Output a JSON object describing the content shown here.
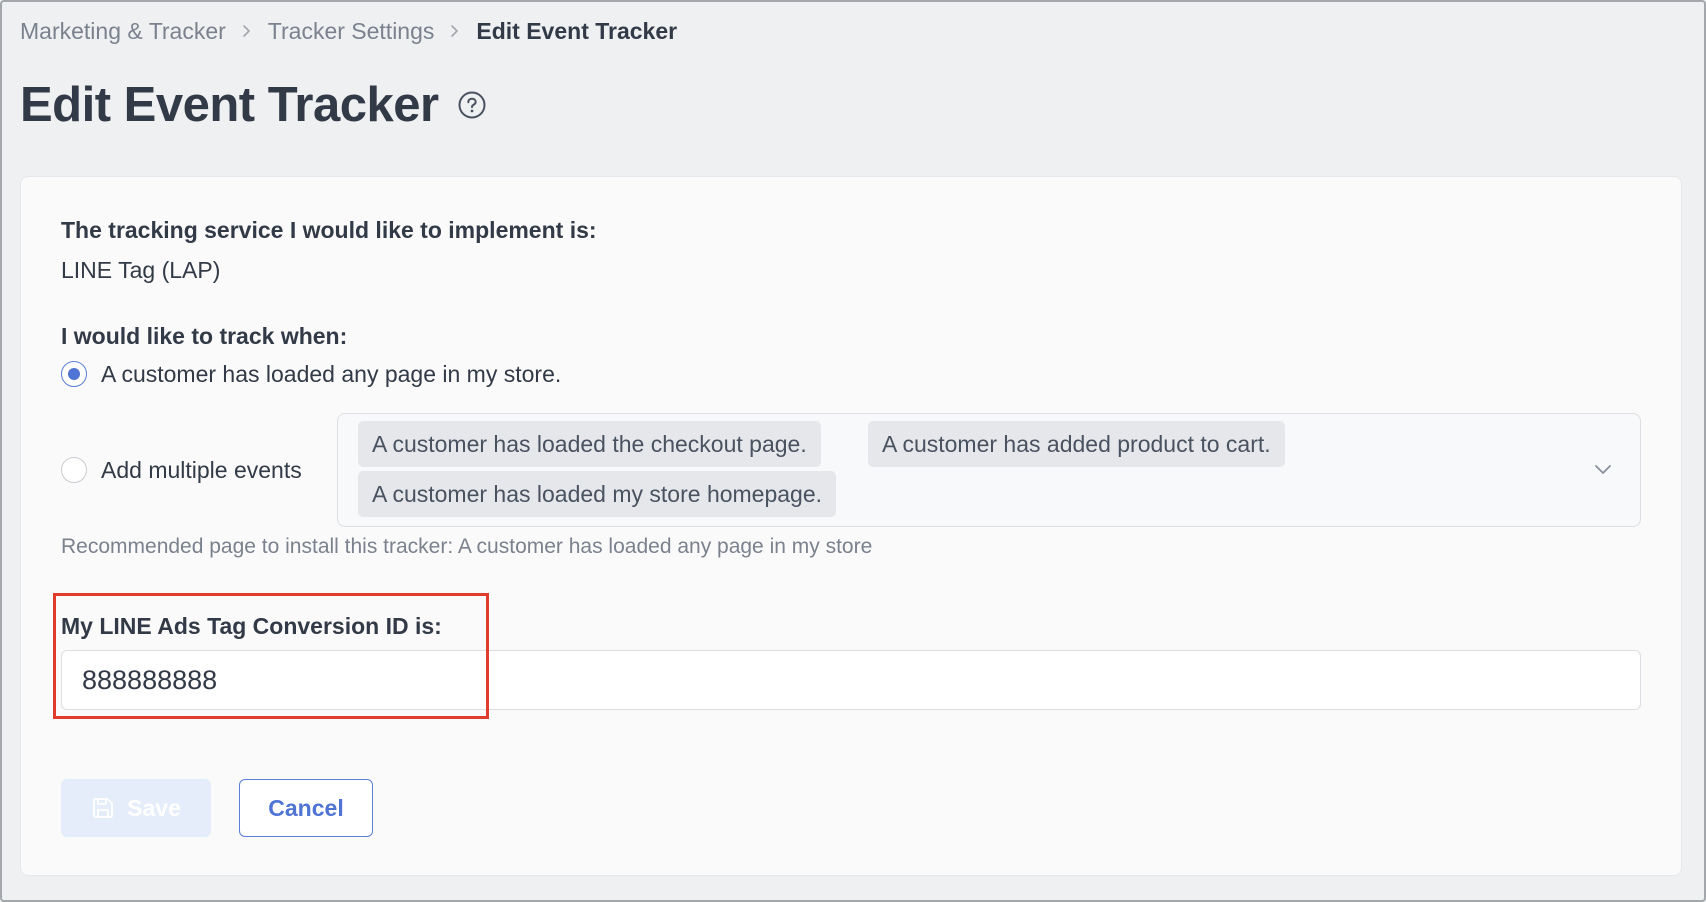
{
  "breadcrumb": {
    "items": [
      {
        "label": "Marketing & Tracker"
      },
      {
        "label": "Tracker Settings"
      },
      {
        "label": "Edit Event Tracker"
      }
    ]
  },
  "page": {
    "title": "Edit Event Tracker",
    "help_icon": "question-circle-icon"
  },
  "form": {
    "service": {
      "label": "The tracking service I would like to implement is:",
      "value": "LINE Tag (LAP)"
    },
    "track_when": {
      "label": "I would like to track when:",
      "options": [
        {
          "label": "A customer has loaded any page in my store.",
          "selected": true
        },
        {
          "label": "Add multiple events",
          "selected": false
        }
      ],
      "multi_events": {
        "tags": [
          "A customer has loaded the checkout page.",
          "A customer has added product to cart.",
          "A customer has loaded my store homepage."
        ],
        "dropdown_icon": "chevron-down-icon"
      },
      "helper": "Recommended page to install this tracker: A customer has loaded any page in my store"
    },
    "conversion_id": {
      "label": "My LINE Ads Tag Conversion ID is:",
      "value": "888888888"
    },
    "buttons": {
      "save_label": "Save",
      "save_icon": "floppy-disk-icon",
      "save_disabled": true,
      "cancel_label": "Cancel"
    }
  },
  "colors": {
    "background": "#eff0f2",
    "card": "#fafafa",
    "text": "#323a47",
    "muted": "#7b828e",
    "accent": "#4f74d3",
    "highlight": "#e03c2d",
    "save_disabled_bg": "#e5edfb"
  }
}
